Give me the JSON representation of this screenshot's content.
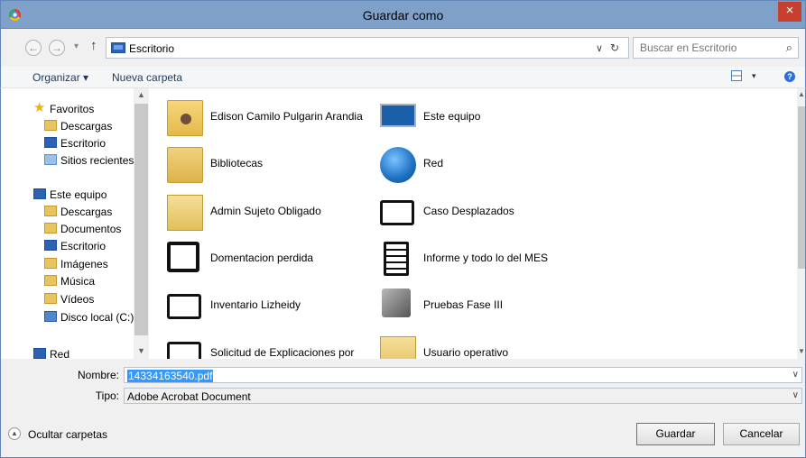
{
  "window": {
    "title": "Guardar como",
    "close_glyph": "×"
  },
  "nav": {
    "back_glyph": "←",
    "forward_glyph": "→",
    "history_glyph": "▾",
    "up_glyph": "↑",
    "address": "Escritorio",
    "address_dd_glyph": "∨",
    "refresh_glyph": "↻",
    "search_placeholder": "Buscar en Escritorio",
    "search_glyph": "⌕"
  },
  "toolbar": {
    "organize": "Organizar ▾",
    "new_folder": "Nueva carpeta",
    "view_dd_glyph": "▾",
    "help_glyph": "?"
  },
  "sidebar": {
    "items": [
      {
        "label": "Favoritos",
        "icon": "star-icon"
      },
      {
        "label": "Descargas",
        "icon": "downloads-icon"
      },
      {
        "label": "Escritorio",
        "icon": "desktop-icon"
      },
      {
        "label": "Sitios recientes",
        "icon": "recent-icon"
      },
      {
        "label": "Este equipo",
        "icon": "computer-icon"
      },
      {
        "label": "Descargas",
        "icon": "downloads-icon"
      },
      {
        "label": "Documentos",
        "icon": "documents-icon"
      },
      {
        "label": "Escritorio",
        "icon": "desktop-icon"
      },
      {
        "label": "Imágenes",
        "icon": "pictures-icon"
      },
      {
        "label": "Música",
        "icon": "music-icon"
      },
      {
        "label": "Vídeos",
        "icon": "videos-icon"
      },
      {
        "label": "Disco local (C:)",
        "icon": "drive-icon"
      },
      {
        "label": "Red",
        "icon": "network-icon"
      }
    ]
  },
  "files": [
    {
      "name": "Edison Camilo Pulgarin Arandia",
      "icon": "user-folder-icon"
    },
    {
      "name": "Este equipo",
      "icon": "computer-icon"
    },
    {
      "name": "Bibliotecas",
      "icon": "libraries-icon"
    },
    {
      "name": "Red",
      "icon": "network-globe-icon"
    },
    {
      "name": "Admin Sujeto Obligado",
      "icon": "folder-icon"
    },
    {
      "name": "Caso Desplazados",
      "icon": "folder-icon"
    },
    {
      "name": "Domentacion perdida",
      "icon": "package-icon"
    },
    {
      "name": "Informe y todo lo del MES",
      "icon": "document-icon"
    },
    {
      "name": "Inventario Lizheidy",
      "icon": "folder-icon"
    },
    {
      "name": "Pruebas Fase III",
      "icon": "tools-icon"
    },
    {
      "name": "Solicitud de Explicaciones por",
      "icon": "folder-icon"
    },
    {
      "name": "Usuario operativo",
      "icon": "folder-icon"
    }
  ],
  "form": {
    "name_label": "Nombre:",
    "name_value": "14334163540.pdf",
    "type_label": "Tipo:",
    "type_value": "Adobe Acrobat Document",
    "dd_glyph": "∨",
    "hide_folders": "Ocultar carpetas",
    "hide_folders_glyph": "▲",
    "save": "Guardar",
    "cancel": "Cancelar"
  }
}
